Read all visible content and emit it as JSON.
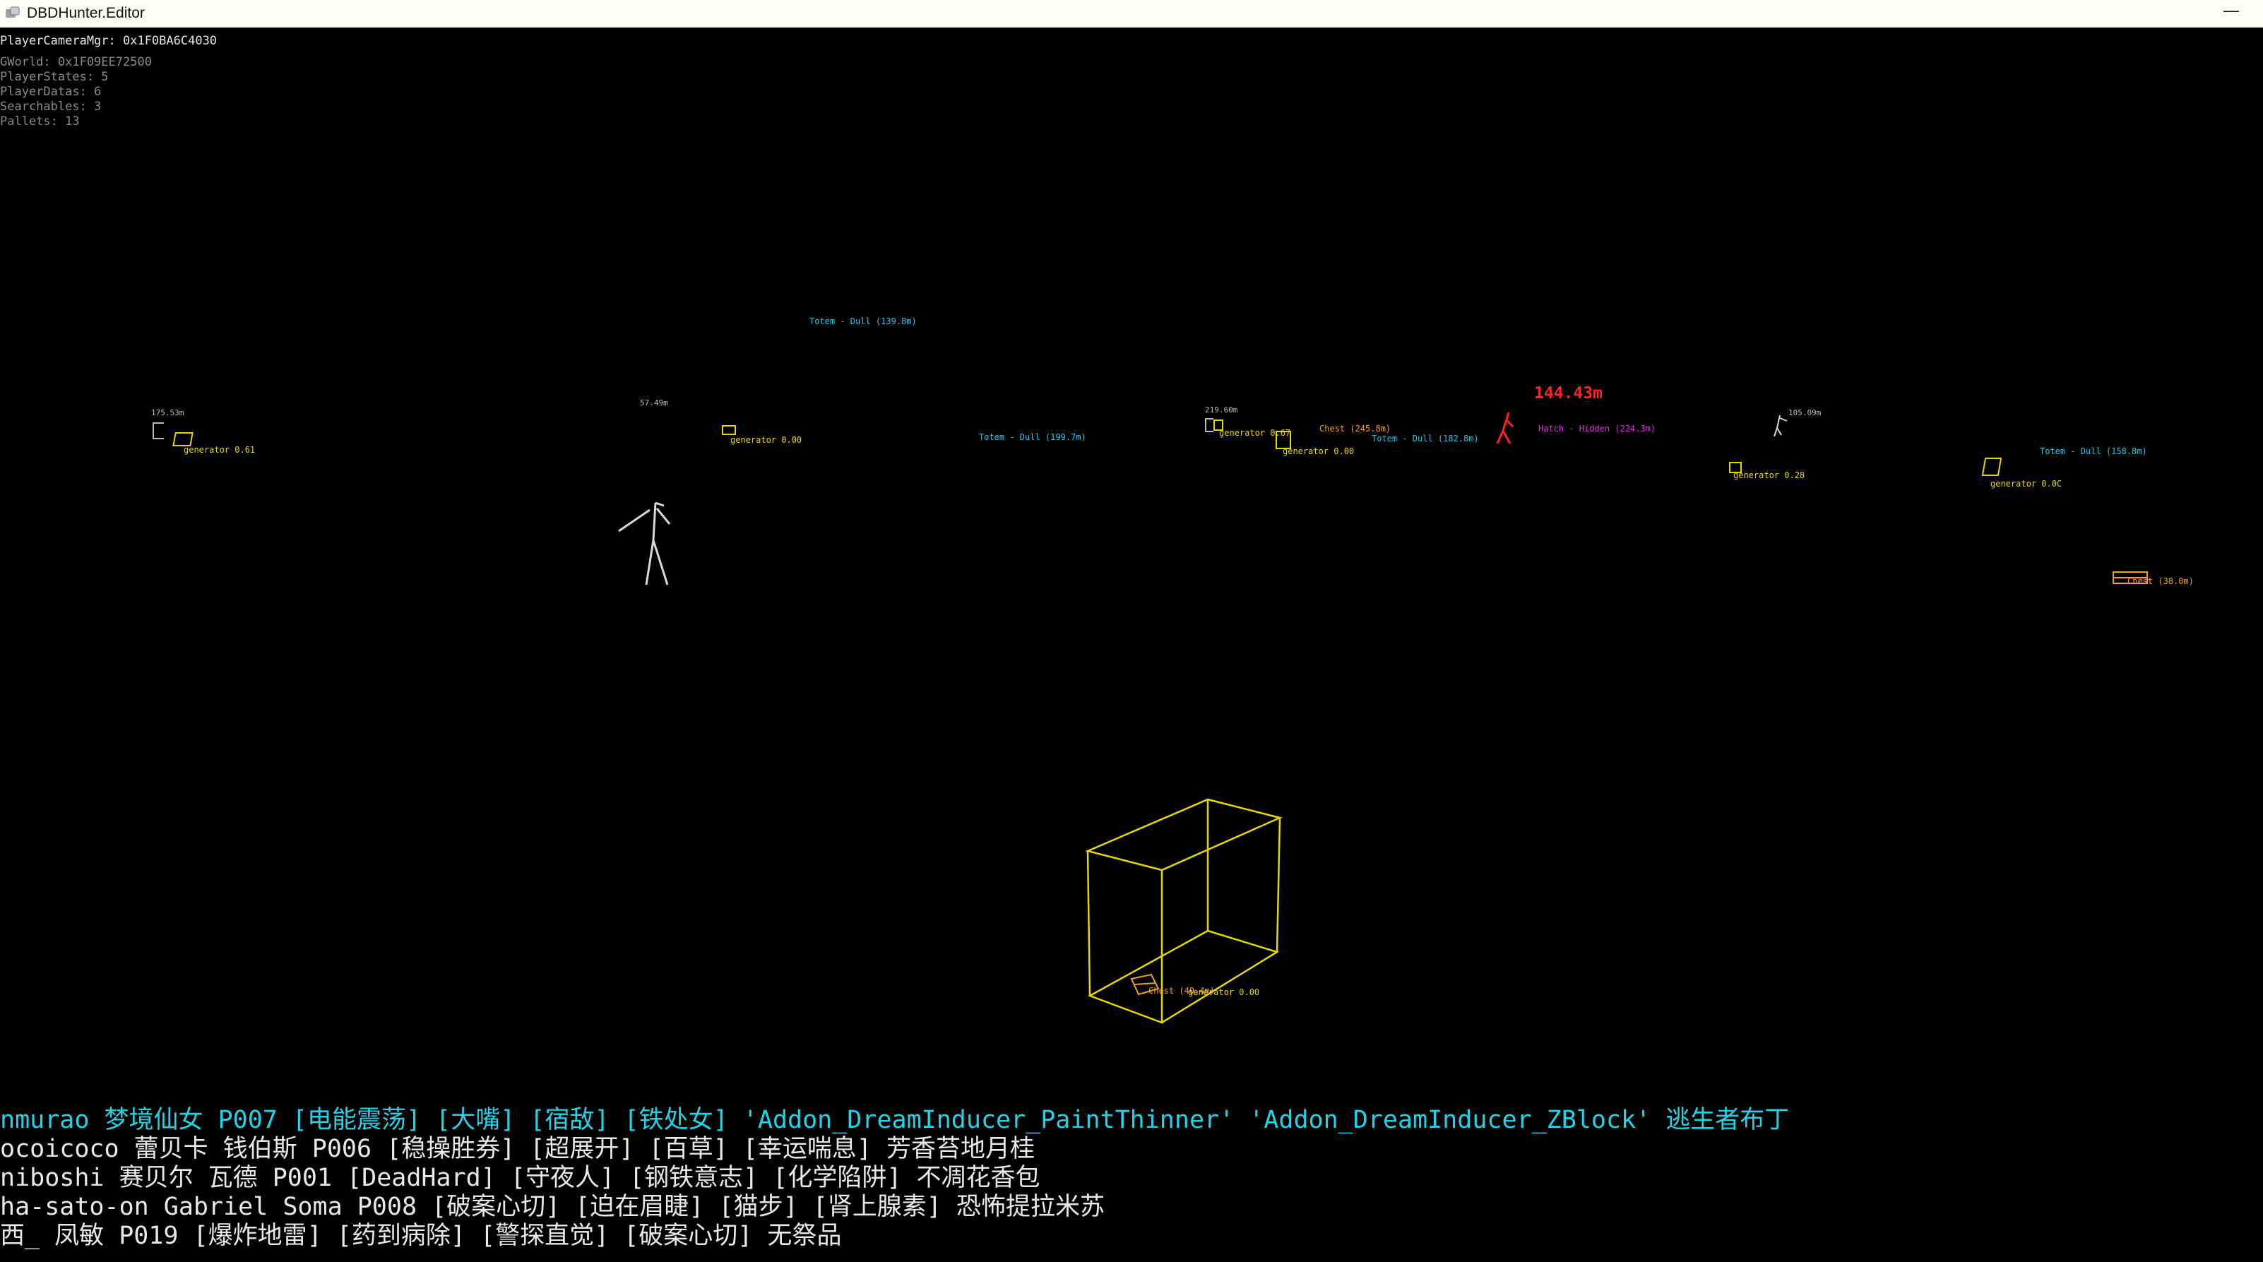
{
  "window": {
    "title": "DBDHunter.Editor",
    "minimize_glyph": "—"
  },
  "debug": {
    "camera": "PlayerCameraMgr: 0x1F0BA6C4030",
    "lines": [
      "GWorld: 0x1F09EE72500",
      "PlayerStates: 5",
      "PlayerDatas: 6",
      "Searchables: 3",
      "Pallets: 13"
    ]
  },
  "world": {
    "distances": [
      "175.53m",
      "57.49m",
      "219.60m",
      "105.09m"
    ],
    "killer_distance": "144.43m",
    "generators": [
      "generator 0.61",
      "generator 0.00",
      "generator 0.00",
      "generator 0.28",
      "generator 0.0C",
      "generator 0.00"
    ],
    "generator_clip": "generator 0.67",
    "totems": [
      "Totem - Dull (139.8m)",
      "Totem - Dull (199.7m)",
      "Totem - Dull (182.8m)",
      "Totem - Dull (158.8m)"
    ],
    "chests": [
      "Chest (245.8m)",
      "Chest (38.0m)",
      "Chest (40.4m)"
    ],
    "hatch": "Hatch - Hidden (224.3m)"
  },
  "players": [
    "nmurao 梦境仙女 P007 [电能震荡] [大嘴] [宿敌] [铁处女] 'Addon_DreamInducer_PaintThinner' 'Addon_DreamInducer_ZBlock' 逃生者布丁",
    "ocoicoco 蕾贝卡 钱伯斯 P006 [稳操胜券] [超展开] [百草] [幸运喘息] 芳香苔地月桂",
    "niboshi 赛贝尔 瓦德 P001 [DeadHard] [守夜人] [钢铁意志] [化学陷阱] 不凋花香包",
    "ha-sato-on Gabriel Soma P008 [破案心切] [迫在眉睫] [猫步] [肾上腺素] 恐怖提拉米苏",
    "西_ 凤敏 P019 [爆炸地雷] [药到病除] [警探直觉] [破案心切] 无祭品"
  ],
  "colors": {
    "generator": "#e6d800",
    "totem": "#22c8e8",
    "chest": "#f0a020",
    "killer": "#ff2222",
    "hatch": "#e030e0",
    "player_highlight": "#22d3e8"
  }
}
